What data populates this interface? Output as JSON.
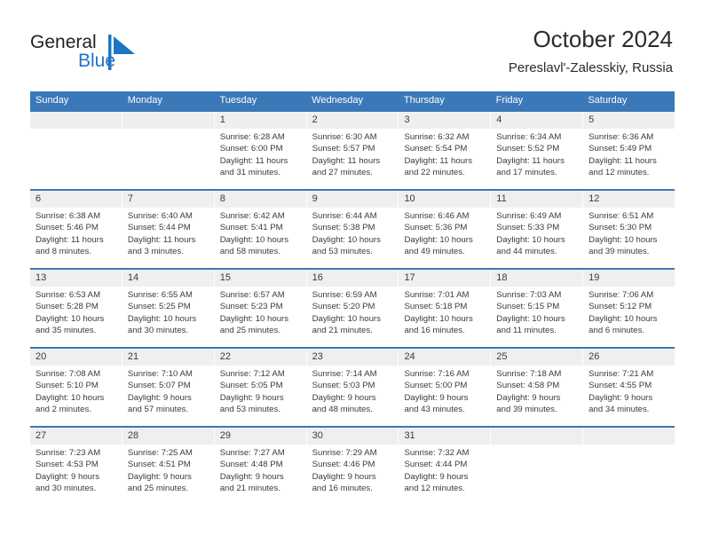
{
  "brand": {
    "name_part1": "General",
    "name_part2": "Blue",
    "mark": "triangle-logo-icon",
    "accent_color": "#1d76c4"
  },
  "header": {
    "title": "October 2024",
    "subtitle": "Pereslavl'-Zalesskiy, Russia"
  },
  "calendar": {
    "header_color": "#3b78b7",
    "day_band_color": "#efefef",
    "weekday_headers": [
      "Sunday",
      "Monday",
      "Tuesday",
      "Wednesday",
      "Thursday",
      "Friday",
      "Saturday"
    ],
    "weeks": [
      [
        {
          "day": "",
          "sunrise": "",
          "sunset": "",
          "daylight_line1": "",
          "daylight_line2": ""
        },
        {
          "day": "",
          "sunrise": "",
          "sunset": "",
          "daylight_line1": "",
          "daylight_line2": ""
        },
        {
          "day": "1",
          "sunrise": "Sunrise: 6:28 AM",
          "sunset": "Sunset: 6:00 PM",
          "daylight_line1": "Daylight: 11 hours",
          "daylight_line2": "and 31 minutes."
        },
        {
          "day": "2",
          "sunrise": "Sunrise: 6:30 AM",
          "sunset": "Sunset: 5:57 PM",
          "daylight_line1": "Daylight: 11 hours",
          "daylight_line2": "and 27 minutes."
        },
        {
          "day": "3",
          "sunrise": "Sunrise: 6:32 AM",
          "sunset": "Sunset: 5:54 PM",
          "daylight_line1": "Daylight: 11 hours",
          "daylight_line2": "and 22 minutes."
        },
        {
          "day": "4",
          "sunrise": "Sunrise: 6:34 AM",
          "sunset": "Sunset: 5:52 PM",
          "daylight_line1": "Daylight: 11 hours",
          "daylight_line2": "and 17 minutes."
        },
        {
          "day": "5",
          "sunrise": "Sunrise: 6:36 AM",
          "sunset": "Sunset: 5:49 PM",
          "daylight_line1": "Daylight: 11 hours",
          "daylight_line2": "and 12 minutes."
        }
      ],
      [
        {
          "day": "6",
          "sunrise": "Sunrise: 6:38 AM",
          "sunset": "Sunset: 5:46 PM",
          "daylight_line1": "Daylight: 11 hours",
          "daylight_line2": "and 8 minutes."
        },
        {
          "day": "7",
          "sunrise": "Sunrise: 6:40 AM",
          "sunset": "Sunset: 5:44 PM",
          "daylight_line1": "Daylight: 11 hours",
          "daylight_line2": "and 3 minutes."
        },
        {
          "day": "8",
          "sunrise": "Sunrise: 6:42 AM",
          "sunset": "Sunset: 5:41 PM",
          "daylight_line1": "Daylight: 10 hours",
          "daylight_line2": "and 58 minutes."
        },
        {
          "day": "9",
          "sunrise": "Sunrise: 6:44 AM",
          "sunset": "Sunset: 5:38 PM",
          "daylight_line1": "Daylight: 10 hours",
          "daylight_line2": "and 53 minutes."
        },
        {
          "day": "10",
          "sunrise": "Sunrise: 6:46 AM",
          "sunset": "Sunset: 5:36 PM",
          "daylight_line1": "Daylight: 10 hours",
          "daylight_line2": "and 49 minutes."
        },
        {
          "day": "11",
          "sunrise": "Sunrise: 6:49 AM",
          "sunset": "Sunset: 5:33 PM",
          "daylight_line1": "Daylight: 10 hours",
          "daylight_line2": "and 44 minutes."
        },
        {
          "day": "12",
          "sunrise": "Sunrise: 6:51 AM",
          "sunset": "Sunset: 5:30 PM",
          "daylight_line1": "Daylight: 10 hours",
          "daylight_line2": "and 39 minutes."
        }
      ],
      [
        {
          "day": "13",
          "sunrise": "Sunrise: 6:53 AM",
          "sunset": "Sunset: 5:28 PM",
          "daylight_line1": "Daylight: 10 hours",
          "daylight_line2": "and 35 minutes."
        },
        {
          "day": "14",
          "sunrise": "Sunrise: 6:55 AM",
          "sunset": "Sunset: 5:25 PM",
          "daylight_line1": "Daylight: 10 hours",
          "daylight_line2": "and 30 minutes."
        },
        {
          "day": "15",
          "sunrise": "Sunrise: 6:57 AM",
          "sunset": "Sunset: 5:23 PM",
          "daylight_line1": "Daylight: 10 hours",
          "daylight_line2": "and 25 minutes."
        },
        {
          "day": "16",
          "sunrise": "Sunrise: 6:59 AM",
          "sunset": "Sunset: 5:20 PM",
          "daylight_line1": "Daylight: 10 hours",
          "daylight_line2": "and 21 minutes."
        },
        {
          "day": "17",
          "sunrise": "Sunrise: 7:01 AM",
          "sunset": "Sunset: 5:18 PM",
          "daylight_line1": "Daylight: 10 hours",
          "daylight_line2": "and 16 minutes."
        },
        {
          "day": "18",
          "sunrise": "Sunrise: 7:03 AM",
          "sunset": "Sunset: 5:15 PM",
          "daylight_line1": "Daylight: 10 hours",
          "daylight_line2": "and 11 minutes."
        },
        {
          "day": "19",
          "sunrise": "Sunrise: 7:06 AM",
          "sunset": "Sunset: 5:12 PM",
          "daylight_line1": "Daylight: 10 hours",
          "daylight_line2": "and 6 minutes."
        }
      ],
      [
        {
          "day": "20",
          "sunrise": "Sunrise: 7:08 AM",
          "sunset": "Sunset: 5:10 PM",
          "daylight_line1": "Daylight: 10 hours",
          "daylight_line2": "and 2 minutes."
        },
        {
          "day": "21",
          "sunrise": "Sunrise: 7:10 AM",
          "sunset": "Sunset: 5:07 PM",
          "daylight_line1": "Daylight: 9 hours",
          "daylight_line2": "and 57 minutes."
        },
        {
          "day": "22",
          "sunrise": "Sunrise: 7:12 AM",
          "sunset": "Sunset: 5:05 PM",
          "daylight_line1": "Daylight: 9 hours",
          "daylight_line2": "and 53 minutes."
        },
        {
          "day": "23",
          "sunrise": "Sunrise: 7:14 AM",
          "sunset": "Sunset: 5:03 PM",
          "daylight_line1": "Daylight: 9 hours",
          "daylight_line2": "and 48 minutes."
        },
        {
          "day": "24",
          "sunrise": "Sunrise: 7:16 AM",
          "sunset": "Sunset: 5:00 PM",
          "daylight_line1": "Daylight: 9 hours",
          "daylight_line2": "and 43 minutes."
        },
        {
          "day": "25",
          "sunrise": "Sunrise: 7:18 AM",
          "sunset": "Sunset: 4:58 PM",
          "daylight_line1": "Daylight: 9 hours",
          "daylight_line2": "and 39 minutes."
        },
        {
          "day": "26",
          "sunrise": "Sunrise: 7:21 AM",
          "sunset": "Sunset: 4:55 PM",
          "daylight_line1": "Daylight: 9 hours",
          "daylight_line2": "and 34 minutes."
        }
      ],
      [
        {
          "day": "27",
          "sunrise": "Sunrise: 7:23 AM",
          "sunset": "Sunset: 4:53 PM",
          "daylight_line1": "Daylight: 9 hours",
          "daylight_line2": "and 30 minutes."
        },
        {
          "day": "28",
          "sunrise": "Sunrise: 7:25 AM",
          "sunset": "Sunset: 4:51 PM",
          "daylight_line1": "Daylight: 9 hours",
          "daylight_line2": "and 25 minutes."
        },
        {
          "day": "29",
          "sunrise": "Sunrise: 7:27 AM",
          "sunset": "Sunset: 4:48 PM",
          "daylight_line1": "Daylight: 9 hours",
          "daylight_line2": "and 21 minutes."
        },
        {
          "day": "30",
          "sunrise": "Sunrise: 7:29 AM",
          "sunset": "Sunset: 4:46 PM",
          "daylight_line1": "Daylight: 9 hours",
          "daylight_line2": "and 16 minutes."
        },
        {
          "day": "31",
          "sunrise": "Sunrise: 7:32 AM",
          "sunset": "Sunset: 4:44 PM",
          "daylight_line1": "Daylight: 9 hours",
          "daylight_line2": "and 12 minutes."
        },
        {
          "day": "",
          "sunrise": "",
          "sunset": "",
          "daylight_line1": "",
          "daylight_line2": ""
        },
        {
          "day": "",
          "sunrise": "",
          "sunset": "",
          "daylight_line1": "",
          "daylight_line2": ""
        }
      ]
    ]
  }
}
